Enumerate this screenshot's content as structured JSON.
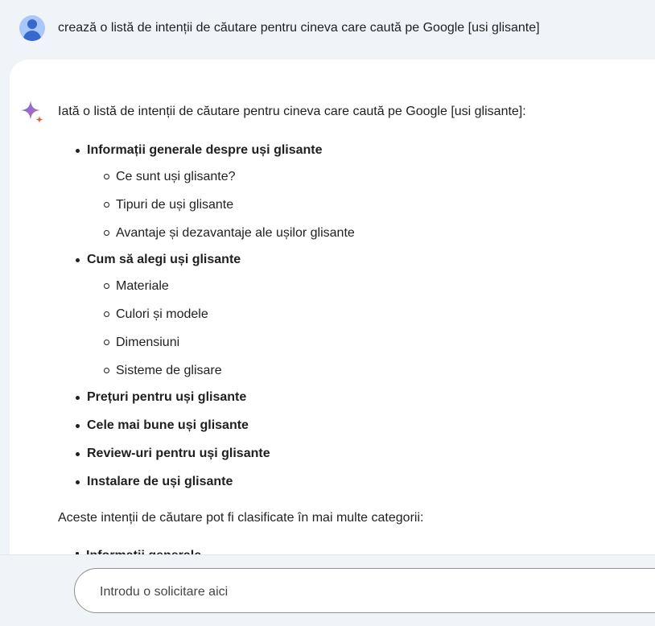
{
  "user": {
    "prompt": "crează o listă de intenții de căutare pentru cineva care caută pe Google [usi glisante]"
  },
  "response": {
    "intro": "Iată o listă de intenții de căutare pentru cineva care caută pe Google [usi glisante]:",
    "items": [
      {
        "label": "Informații generale despre uși glisante",
        "subitems": [
          "Ce sunt uși glisante?",
          "Tipuri de uși glisante",
          "Avantaje și dezavantaje ale ușilor glisante"
        ]
      },
      {
        "label": "Cum să alegi uși glisante",
        "subitems": [
          "Materiale",
          "Culori și modele",
          "Dimensiuni",
          "Sisteme de glisare"
        ]
      },
      {
        "label": "Prețuri pentru uși glisante",
        "subitems": []
      },
      {
        "label": "Cele mai bune uși glisante",
        "subitems": []
      },
      {
        "label": "Review-uri pentru uși glisante",
        "subitems": []
      },
      {
        "label": "Instalare de uși glisante",
        "subitems": []
      }
    ],
    "closing": "Aceste intenții de căutare pot fi clasificate în mai multe categorii:",
    "cutoff_item": "Informații generale"
  },
  "input": {
    "placeholder": "Introdu o solicitare aici"
  },
  "icons": {
    "user_avatar": "user-avatar-icon",
    "assistant": "sparkle-icon"
  },
  "colors": {
    "background": "#f0f4f9",
    "card": "#ffffff",
    "avatar": "#a8c7fa",
    "avatar_figure": "#3868cc",
    "spark_blue": "#4b7bd8",
    "spark_red": "#d9654b"
  }
}
